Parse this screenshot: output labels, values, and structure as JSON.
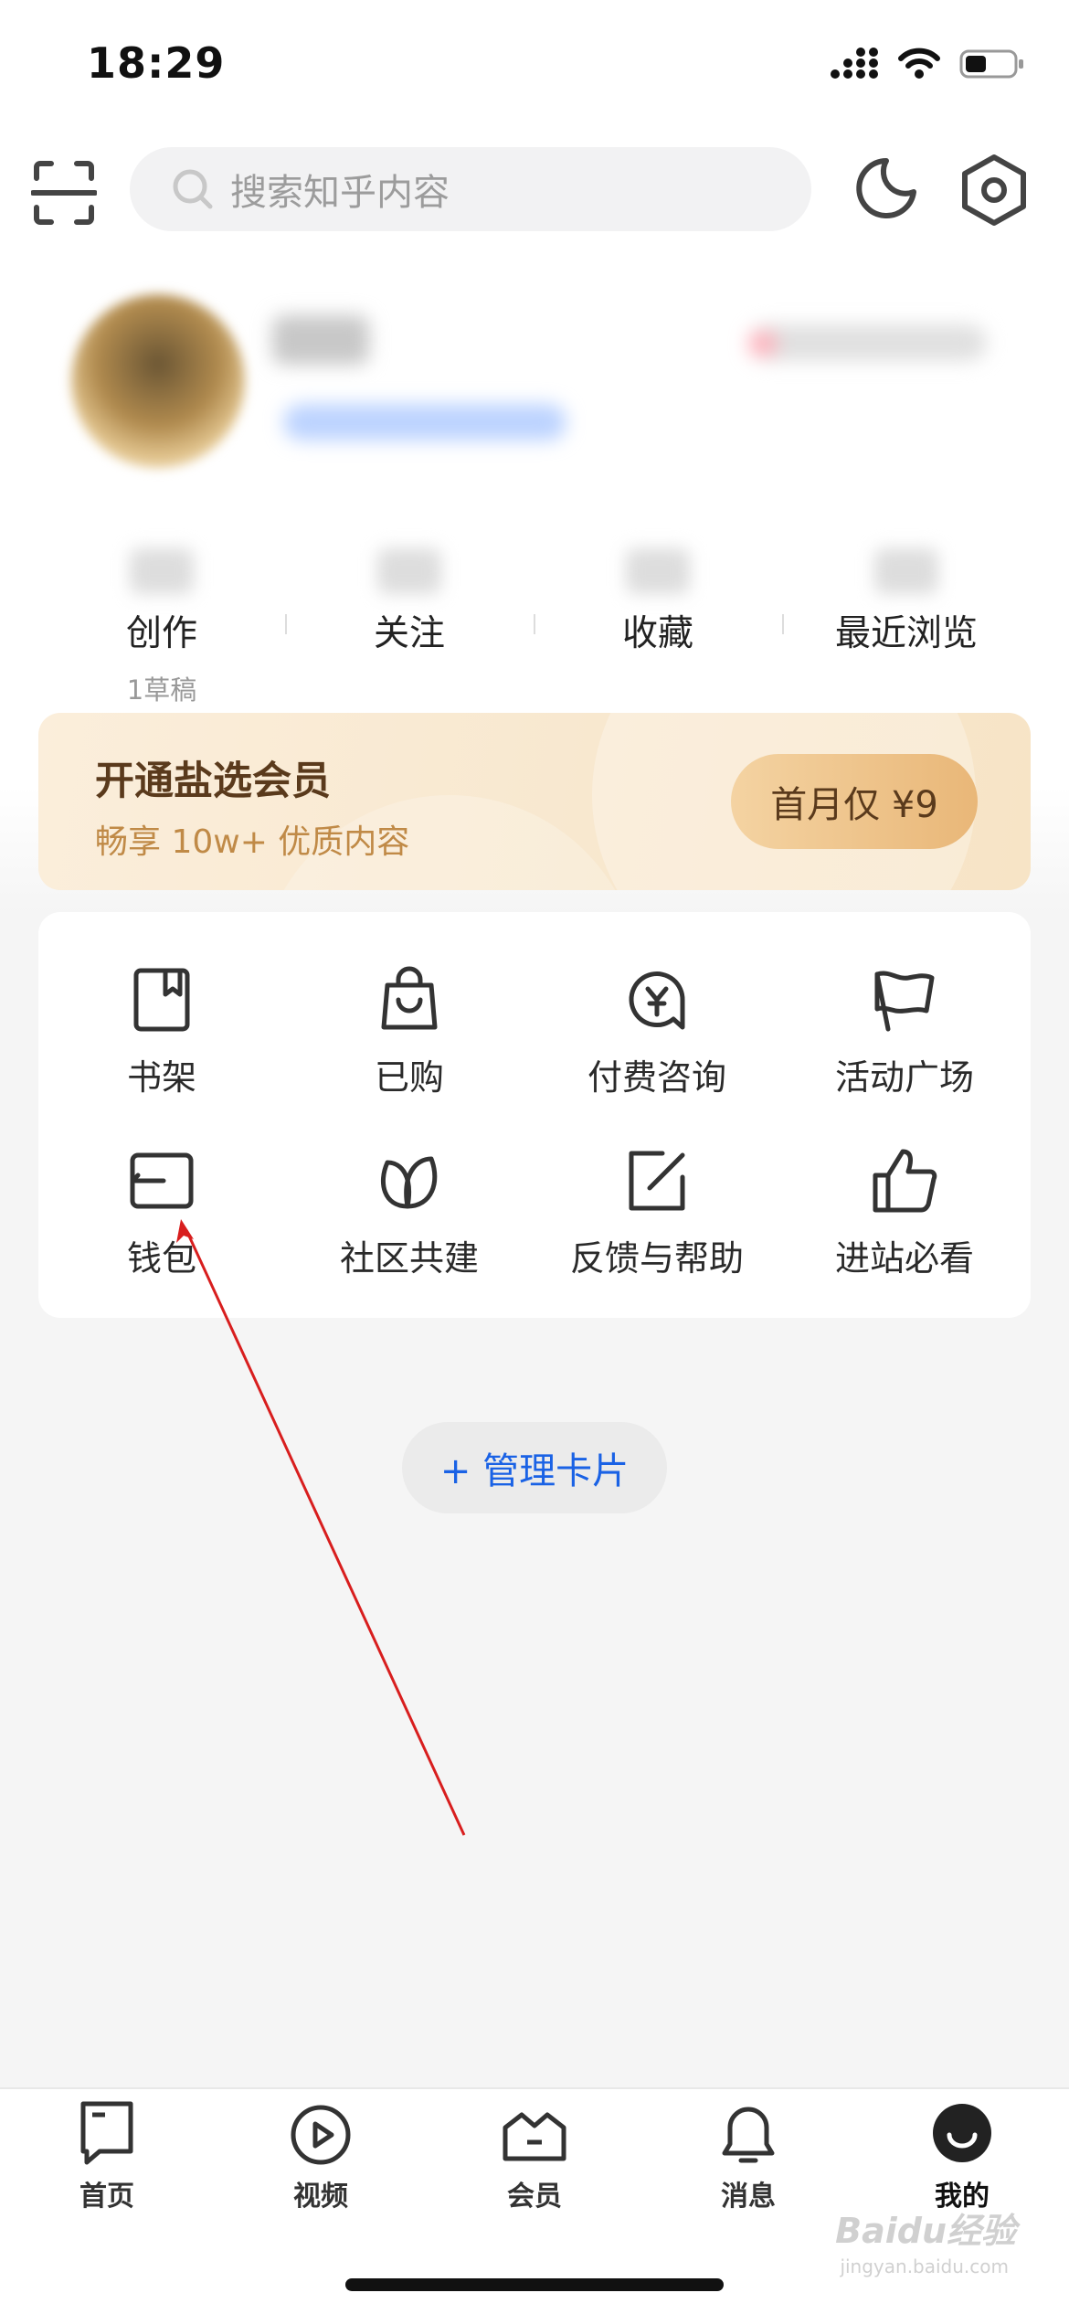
{
  "status_bar": {
    "time": "18:29"
  },
  "search": {
    "placeholder": "搜索知乎内容"
  },
  "stats": [
    {
      "label": "创作",
      "sub": "1草稿"
    },
    {
      "label": "关注"
    },
    {
      "label": "收藏"
    },
    {
      "label": "最近浏览"
    }
  ],
  "vip": {
    "title": "开通盐选会员",
    "subtitle": "畅享 10w+ 优质内容",
    "button": "首月仅 ¥9"
  },
  "tools": [
    {
      "label": "书架",
      "icon": "bookshelf-icon"
    },
    {
      "label": "已购",
      "icon": "shopping-bag-icon"
    },
    {
      "label": "付费咨询",
      "icon": "paid-consult-icon"
    },
    {
      "label": "活动广场",
      "icon": "flag-icon"
    },
    {
      "label": "钱包",
      "icon": "wallet-icon"
    },
    {
      "label": "社区共建",
      "icon": "community-leaf-icon"
    },
    {
      "label": "反馈与帮助",
      "icon": "feedback-edit-icon"
    },
    {
      "label": "进站必看",
      "icon": "thumbs-up-icon"
    }
  ],
  "manage_cards": "+ 管理卡片",
  "tabbar": [
    {
      "label": "首页",
      "icon": "home-icon"
    },
    {
      "label": "视频",
      "icon": "video-play-icon"
    },
    {
      "label": "会员",
      "icon": "crown-icon"
    },
    {
      "label": "消息",
      "icon": "bell-icon"
    },
    {
      "label": "我的",
      "icon": "profile-face-icon",
      "active": true
    }
  ],
  "watermark": {
    "brand": "Baidu经验",
    "url": "jingyan.baidu.com"
  },
  "colors": {
    "accent_blue": "#1a62e5",
    "vip_text": "#5a3a1c",
    "vip_sub": "#c08a47",
    "annotation_red": "#d81e1e"
  }
}
